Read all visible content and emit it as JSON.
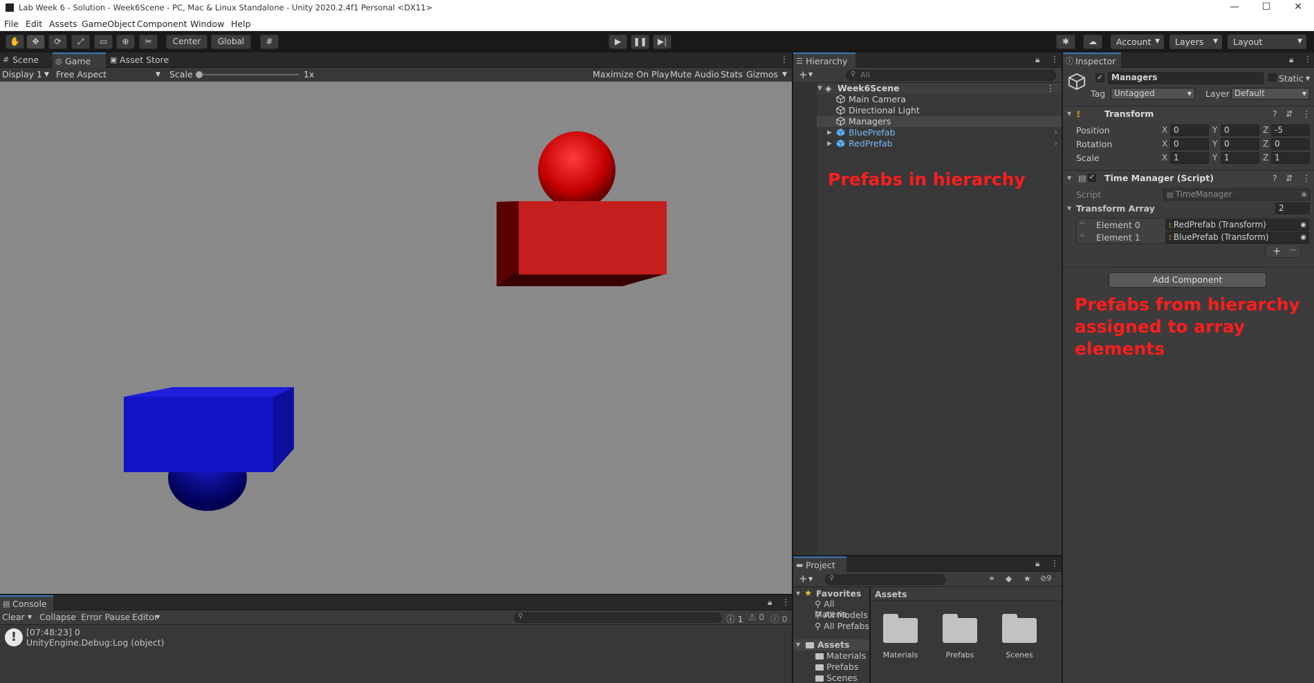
{
  "window": {
    "title": "Lab Week 6 - Solution - Week6Scene - PC, Mac & Linux Standalone - Unity 2020.2.4f1 Personal <DX11>",
    "minimize": "—",
    "maximize": "☐",
    "close": "✕"
  },
  "menu": [
    "File",
    "Edit",
    "Assets",
    "GameObject",
    "Component",
    "Window",
    "Help"
  ],
  "toolbar": {
    "pivot": "Center",
    "space": "Global",
    "account": "Account",
    "layers": "Layers",
    "layout": "Layout"
  },
  "game": {
    "tabs": [
      "Scene",
      "Game",
      "Asset Store"
    ],
    "display": "Display 1",
    "aspect": "Free Aspect",
    "scale_label": "Scale",
    "scale_value": "1x",
    "maximize_on_play": "Maximize On Play",
    "mute_audio": "Mute Audio",
    "stats": "Stats",
    "gizmos": "Gizmos"
  },
  "hierarchy": {
    "tab": "Hierarchy",
    "search_placeholder": "All",
    "scene": "Week6Scene",
    "items": [
      {
        "label": "Main Camera",
        "prefab": false
      },
      {
        "label": "Directional Light",
        "prefab": false
      },
      {
        "label": "Managers",
        "prefab": false,
        "selected": true
      },
      {
        "label": "BluePrefab",
        "prefab": true
      },
      {
        "label": "RedPrefab",
        "prefab": true
      }
    ],
    "annotation": "Prefabs in hierarchy"
  },
  "inspector": {
    "tab": "Inspector",
    "object_name": "Managers",
    "static_label": "Static",
    "tag_label": "Tag",
    "tag_value": "Untagged",
    "layer_label": "Layer",
    "layer_value": "Default",
    "transform": {
      "title": "Transform",
      "position_label": "Position",
      "rotation_label": "Rotation",
      "scale_label": "Scale",
      "position": {
        "x": "0",
        "y": "0",
        "z": "-5"
      },
      "rotation": {
        "x": "0",
        "y": "0",
        "z": "0"
      },
      "scale": {
        "x": "1",
        "y": "1",
        "z": "1"
      }
    },
    "time_manager": {
      "title": "Time Manager (Script)",
      "script_label": "Script",
      "script_value": "TimeManager",
      "array_label": "Transform Array",
      "array_size": "2",
      "elements": [
        {
          "label": "Element 0",
          "value": "RedPrefab (Transform)"
        },
        {
          "label": "Element 1",
          "value": "BluePrefab (Transform)"
        }
      ]
    },
    "add_component": "Add Component",
    "annotation": "Prefabs from hierarchy assigned to array elements"
  },
  "console": {
    "tab": "Console",
    "clear": "Clear",
    "collapse": "Collapse",
    "error_pause": "Error Pause",
    "editor": "Editor",
    "count_log": "1",
    "count_warn": "0",
    "count_error": "0",
    "log_line1": "[07:48:23] 0",
    "log_line2": "UnityEngine.Debug:Log (object)"
  },
  "project": {
    "tab": "Project",
    "hidden_count": "9",
    "favorites_label": "Favorites",
    "favorites": [
      "All Materia",
      "All Models",
      "All Prefabs"
    ],
    "assets_label": "Assets",
    "assets_tree": [
      "Materials",
      "Prefabs",
      "Scenes"
    ],
    "breadcrumb": "Assets",
    "folders": [
      "Materials",
      "Prefabs",
      "Scenes"
    ]
  },
  "colors": {
    "red_object": "#c41e1e",
    "blue_object": "#1414c8",
    "prefab_text": "#7ab8f5",
    "annotation": "#ff1d1d"
  }
}
